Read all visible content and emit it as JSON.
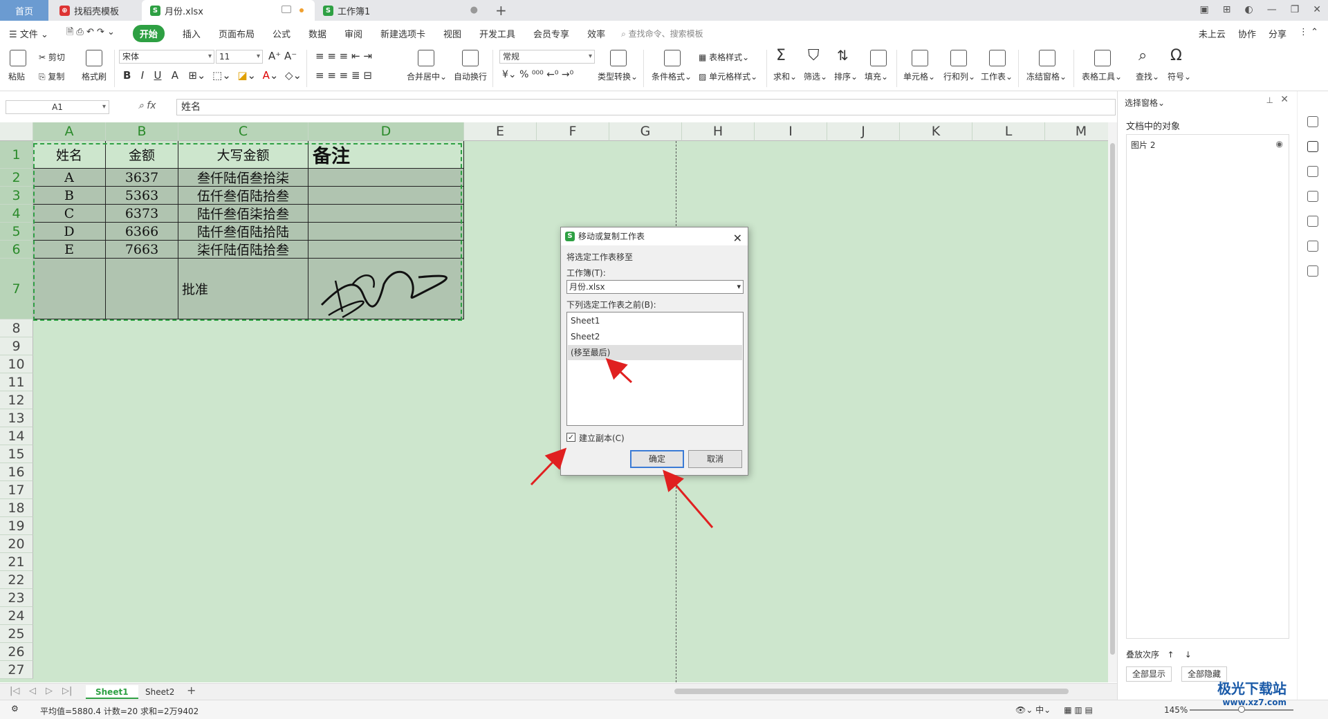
{
  "tabs": {
    "home": "首页",
    "items": [
      {
        "label": "找稻壳模板"
      },
      {
        "label": "月份.xlsx"
      },
      {
        "label": "工作簿1"
      }
    ],
    "new_tab": "+"
  },
  "menu": {
    "file": "文件",
    "items": [
      "开始",
      "插入",
      "页面布局",
      "公式",
      "数据",
      "审阅",
      "新建选项卡",
      "视图",
      "开发工具",
      "会员专享",
      "效率"
    ],
    "search": "查找命令、搜索模板",
    "right": [
      "未上云",
      "协作",
      "分享"
    ]
  },
  "ribbon": {
    "paste": "粘贴",
    "cut": "剪切",
    "copy": "复制",
    "format_painter": "格式刷",
    "font_name": "宋体",
    "font_size": "11",
    "number_format": "常规",
    "merge": "合并居中",
    "wrap": "自动换行",
    "type_convert": "类型转换",
    "cond_format": "条件格式",
    "table_style": "表格样式",
    "cell_style": "单元格样式",
    "sum": "求和",
    "filter": "筛选",
    "sort": "排序",
    "fill": "填充",
    "cell": "单元格",
    "rowcol": "行和列",
    "sheet": "工作表",
    "freeze": "冻结窗格",
    "table_tools": "表格工具",
    "find": "查找",
    "symbol": "符号"
  },
  "formula_bar": {
    "cell_ref": "A1",
    "fx": "fx",
    "value": "姓名"
  },
  "grid": {
    "columns": [
      "A",
      "B",
      "C",
      "D",
      "E",
      "F",
      "G",
      "H",
      "I",
      "J",
      "K",
      "L",
      "M"
    ],
    "rows": [
      "1",
      "2",
      "3",
      "4",
      "5",
      "6",
      "7",
      "8",
      "9",
      "10",
      "11",
      "12",
      "13",
      "14",
      "15",
      "16",
      "17",
      "18",
      "19",
      "20",
      "21",
      "22",
      "23",
      "24",
      "25",
      "26",
      "27"
    ],
    "header": [
      "姓名",
      "金额",
      "大写金额",
      "备注"
    ],
    "data": [
      [
        "A",
        "3637",
        "叁仟陆佰叁拾柒",
        ""
      ],
      [
        "B",
        "5363",
        "伍仟叁佰陆拾叁",
        ""
      ],
      [
        "C",
        "6373",
        "陆仟叁佰柒拾叁",
        ""
      ],
      [
        "D",
        "6366",
        "陆仟叁佰陆拾陆",
        ""
      ],
      [
        "E",
        "7663",
        "柒仟陆佰陆拾叁",
        ""
      ]
    ],
    "approve_label": "批准"
  },
  "sheets": {
    "tabs": [
      "Sheet1",
      "Sheet2"
    ],
    "add": "+"
  },
  "status": {
    "stats": "平均值=5880.4  计数=20  求和=2万9402",
    "zoom": "145%"
  },
  "selection_pane": {
    "title": "选择窗格",
    "objects_label": "文档中的对象",
    "object_item": "图片 2",
    "order_label": "叠放次序",
    "show_all": "全部显示",
    "hide_all": "全部隐藏"
  },
  "dialog": {
    "title": "移动或复制工作表",
    "move_label": "将选定工作表移至",
    "workbook_label": "工作簿(T):",
    "workbook_value": "月份.xlsx",
    "before_label": "下列选定工作表之前(B):",
    "list_items": [
      "Sheet1",
      "Sheet2",
      "(移至最后)"
    ],
    "selected_index": 2,
    "copy_label": "建立副本(C)",
    "copy_checked": true,
    "ok": "确定",
    "cancel": "取消"
  },
  "watermark": {
    "line1": "极光下载站",
    "line2": "www.xz7.com"
  },
  "colors": {
    "accent": "#2ea043",
    "grid_bg": "#cde6cd",
    "table_fill": "#b0c4b0",
    "arrow": "#e02020"
  }
}
